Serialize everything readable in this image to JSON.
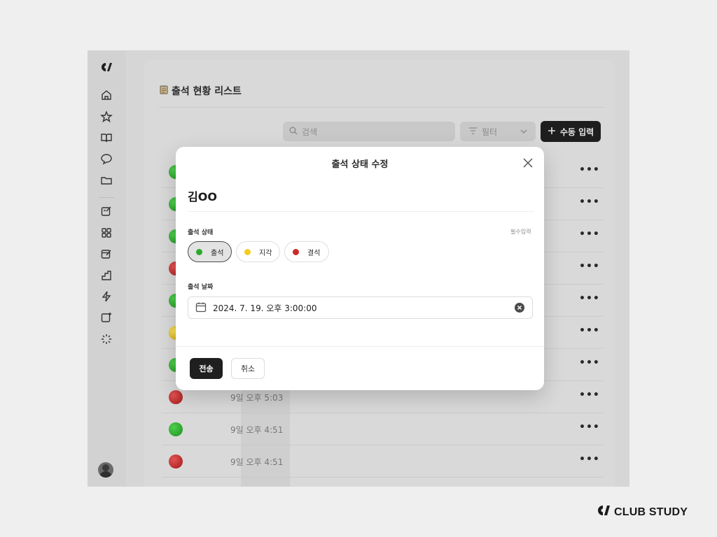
{
  "sidebar": {
    "logo_icon": "club-study-logo-icon",
    "items": [
      "home-icon",
      "star-icon",
      "book-icon",
      "chat-icon",
      "folder-icon",
      "note-edit-icon",
      "grid-icon",
      "calendar-edit-icon",
      "stairs-icon",
      "lightning-icon",
      "sparkle-edit-icon",
      "loader-icon"
    ]
  },
  "page": {
    "title": "출석 현황 리스트",
    "title_icon": "clipboard-icon",
    "search_placeholder": "검색",
    "filter_label": "필터",
    "manual_entry_label": "수동 입력"
  },
  "rows": [
    {
      "status": "green",
      "time": ""
    },
    {
      "status": "green",
      "time": ""
    },
    {
      "status": "green",
      "time": ""
    },
    {
      "status": "red",
      "time": ""
    },
    {
      "status": "green",
      "time": ""
    },
    {
      "status": "yellow",
      "time": ""
    },
    {
      "status": "green",
      "time": ""
    },
    {
      "status": "red",
      "time": "9일 오후 5:03"
    },
    {
      "status": "green",
      "time": "9일 오후 4:51"
    },
    {
      "status": "red",
      "time": "9일 오후 4:51"
    }
  ],
  "row_menu_label": "•••",
  "modal": {
    "title": "출석 상태 수정",
    "student_name": "김OO",
    "status_label": "출석 상태",
    "required_label": "필수입력",
    "options": [
      {
        "label": "출석",
        "color": "#2ea82e",
        "selected": true
      },
      {
        "label": "지각",
        "color": "#f2cf1d",
        "selected": false
      },
      {
        "label": "결석",
        "color": "#cc2a2a",
        "selected": false
      }
    ],
    "date_label": "출석 날짜",
    "date_value": "2024. 7. 19. 오후 3:00:00",
    "submit_label": "전송",
    "cancel_label": "취소"
  },
  "brand": {
    "name": "CLUB STUDY"
  },
  "colors": {
    "accent": "#1f1f1f",
    "overlay": "#d6d6d6"
  }
}
